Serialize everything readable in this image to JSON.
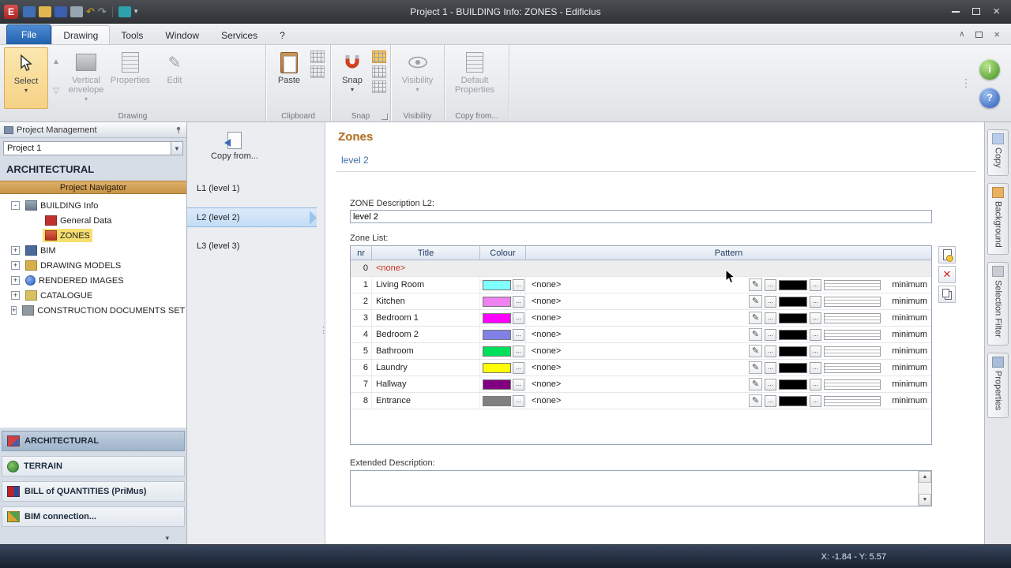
{
  "window": {
    "title": "Project 1 -  BUILDING Info: ZONES - Edificius"
  },
  "menu_tabs": {
    "file": "File",
    "drawing": "Drawing",
    "tools": "Tools",
    "window": "Window",
    "services": "Services",
    "help": "?"
  },
  "ribbon": {
    "select": "Select",
    "vertical_envelope": "Vertical envelope",
    "properties": "Properties",
    "edit": "Edit",
    "paste": "Paste",
    "snap": "Snap",
    "visibility": "Visibility",
    "default_properties": "Default Properties",
    "group_drawing": "Drawing",
    "group_clipboard": "Clipboard",
    "group_snap": "Snap",
    "group_visibility": "Visibility",
    "group_copy_from": "Copy from..."
  },
  "project_panel": {
    "header": "Project Management",
    "project_name": "Project 1",
    "section": "ARCHITECTURAL",
    "navigator": "Project Navigator",
    "tree": [
      {
        "label": "BUILDING Info",
        "expander": "-",
        "level": 0,
        "icon": "building"
      },
      {
        "label": "General Data",
        "level": 1,
        "icon": "general-data"
      },
      {
        "label": "ZONES",
        "level": 1,
        "icon": "zones",
        "selected": true
      },
      {
        "label": "BIM",
        "expander": "+",
        "level": 0,
        "icon": "bim"
      },
      {
        "label": "DRAWING MODELS",
        "expander": "+",
        "level": 0,
        "icon": "drawing-models"
      },
      {
        "label": "RENDERED IMAGES",
        "expander": "+",
        "level": 0,
        "icon": "rendered-images"
      },
      {
        "label": "CATALOGUE",
        "expander": "+",
        "level": 0,
        "icon": "catalogue"
      },
      {
        "label": "CONSTRUCTION DOCUMENTS SET",
        "expander": "+",
        "level": 0,
        "icon": "construction-docs"
      }
    ],
    "bottom_nav": [
      {
        "label": "ARCHITECTURAL",
        "icon": "architectural",
        "selected": true
      },
      {
        "label": "TERRAIN",
        "icon": "terrain"
      },
      {
        "label": "BILL of QUANTITIES (PriMus)",
        "icon": "primus"
      },
      {
        "label": "BIM connection...",
        "icon": "bim-connection"
      }
    ]
  },
  "levels_panel": {
    "copy_from": "Copy from...",
    "items": [
      {
        "label": "L1 (level 1)"
      },
      {
        "label": "L2 (level 2)",
        "selected": true
      },
      {
        "label": "L3 (level 3)"
      }
    ]
  },
  "zones_page": {
    "title": "Zones",
    "subtitle": "level 2",
    "description_label": "ZONE Description L2:",
    "description_value": "level 2",
    "zone_list_label": "Zone List:",
    "extended_description_label": "Extended Description:",
    "table": {
      "headers": {
        "nr": "nr",
        "title": "Title",
        "colour": "Colour",
        "pattern": "Pattern"
      },
      "none_text": "<none>",
      "rows": [
        {
          "nr": "0",
          "title": "<none>",
          "empty": true
        },
        {
          "nr": "1",
          "title": "Living Room",
          "colour": "#7FFFFF",
          "pattern": "<none>",
          "pattern_colour": "#000000",
          "density": "minimum"
        },
        {
          "nr": "2",
          "title": "Kitchen",
          "colour": "#EE82EE",
          "pattern": "<none>",
          "pattern_colour": "#000000",
          "density": "minimum"
        },
        {
          "nr": "3",
          "title": "Bedroom 1",
          "colour": "#FF00FF",
          "pattern": "<none>",
          "pattern_colour": "#000000",
          "density": "minimum"
        },
        {
          "nr": "4",
          "title": "Bedroom 2",
          "colour": "#8080E6",
          "pattern": "<none>",
          "pattern_colour": "#000000",
          "density": "minimum"
        },
        {
          "nr": "5",
          "title": "Bathroom",
          "colour": "#00E05A",
          "pattern": "<none>",
          "pattern_colour": "#000000",
          "density": "minimum"
        },
        {
          "nr": "6",
          "title": "Laundry",
          "colour": "#FFFF00",
          "pattern": "<none>",
          "pattern_colour": "#000000",
          "density": "minimum"
        },
        {
          "nr": "7",
          "title": "Hallway",
          "colour": "#800080",
          "pattern": "<none>",
          "pattern_colour": "#000000",
          "density": "minimum"
        },
        {
          "nr": "8",
          "title": "Entrance",
          "colour": "#808080",
          "pattern": "<none>",
          "pattern_colour": "#000000",
          "density": "minimum"
        }
      ]
    }
  },
  "right_tabs": [
    {
      "label": "Copy",
      "icon": "copy"
    },
    {
      "label": "Background",
      "icon": "background"
    },
    {
      "label": "Selection Filter",
      "icon": "selection-filter"
    },
    {
      "label": "Properties",
      "icon": "properties"
    }
  ],
  "status_bar": {
    "coordinates": "X: -1.84 - Y: 5.57"
  }
}
